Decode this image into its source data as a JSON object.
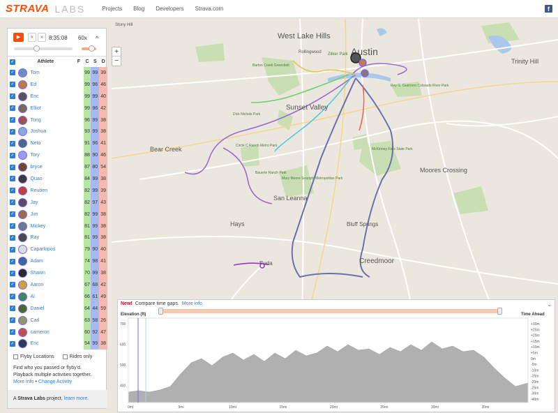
{
  "topbar": {
    "brand": "STRAVA",
    "brand_sub": "LABS",
    "nav": [
      "Projects",
      "Blog",
      "Developers",
      "Strava.com"
    ],
    "facebook_label": "f"
  },
  "map": {
    "labels": [
      "West Lake Hills",
      "Sunset Valley",
      "Bear Creek",
      "San Leanna",
      "Hays",
      "Creedmoor",
      "Moores Crossing",
      "Trinity Hill",
      "Austin",
      "Barton Creek Greenbelt",
      "Mary Moore Searight Metropolitan Park",
      "McKinney Falls State Park",
      "Circle C Ranch Metro Park",
      "Dick Nichols Park",
      "Bauerle Ranch Park",
      "Roy G. Guerrero Colorado River Park",
      "Stony Hill",
      "Rollingwood",
      "Zilker Park",
      "Bluff Springs",
      "Buda"
    ],
    "zoom_in": "+",
    "zoom_out": "−"
  },
  "player": {
    "play_icon": "play-icon",
    "back_label": "«",
    "forward_label": "»",
    "time": "8:35:08",
    "speed": "60x",
    "collapse": "^",
    "timeline_fraction": 0.35,
    "speed_fraction": 0.5
  },
  "table": {
    "headers": {
      "athlete": "Athlete",
      "f": "F",
      "c": "C",
      "s": "S",
      "d": "D"
    },
    "rows": [
      {
        "name": "Tom",
        "f": "",
        "c": "99",
        "s": "99",
        "d": "39"
      },
      {
        "name": "Ed",
        "f": "",
        "c": "99",
        "s": "96",
        "d": "46"
      },
      {
        "name": "Eric",
        "f": "",
        "c": "99",
        "s": "99",
        "d": "40"
      },
      {
        "name": "Elliot",
        "f": "",
        "c": "99",
        "s": "96",
        "d": "42"
      },
      {
        "name": "Tong",
        "f": "",
        "c": "96",
        "s": "99",
        "d": "38"
      },
      {
        "name": "Joshua",
        "f": "",
        "c": "93",
        "s": "99",
        "d": "38"
      },
      {
        "name": "Neto",
        "f": "",
        "c": "91",
        "s": "96",
        "d": "41"
      },
      {
        "name": "Tory",
        "f": "",
        "c": "88",
        "s": "90",
        "d": "46"
      },
      {
        "name": "bryce",
        "f": "",
        "c": "87",
        "s": "80",
        "d": "54"
      },
      {
        "name": "Quao",
        "f": "",
        "c": "84",
        "s": "99",
        "d": "38"
      },
      {
        "name": "Reuben",
        "f": "",
        "c": "82",
        "s": "99",
        "d": "39"
      },
      {
        "name": "Jay",
        "f": "",
        "c": "82",
        "s": "97",
        "d": "43"
      },
      {
        "name": "Jim",
        "f": "",
        "c": "82",
        "s": "99",
        "d": "38"
      },
      {
        "name": "Mickey",
        "f": "",
        "c": "81",
        "s": "99",
        "d": "38"
      },
      {
        "name": "Ray",
        "f": "",
        "c": "81",
        "s": "99",
        "d": "38"
      },
      {
        "name": "Caparlopos",
        "f": "",
        "c": "79",
        "s": "90",
        "d": "40"
      },
      {
        "name": "Adam",
        "f": "",
        "c": "74",
        "s": "98",
        "d": "41"
      },
      {
        "name": "Shawn",
        "f": "",
        "c": "70",
        "s": "99",
        "d": "38"
      },
      {
        "name": "Aaron",
        "f": "",
        "c": "67",
        "s": "68",
        "d": "42"
      },
      {
        "name": "Al",
        "f": "",
        "c": "66",
        "s": "61",
        "d": "49"
      },
      {
        "name": "Daniel",
        "f": "",
        "c": "64",
        "s": "44",
        "d": "59"
      },
      {
        "name": "Carl",
        "f": "",
        "c": "63",
        "s": "58",
        "d": "26"
      },
      {
        "name": "cameron",
        "f": "",
        "c": "60",
        "s": "92",
        "d": "47"
      },
      {
        "name": "Eric",
        "f": "",
        "c": "54",
        "s": "99",
        "d": "38"
      }
    ]
  },
  "footer": {
    "flyby_locations": "Flyby Locations",
    "rides_only": "Rides only",
    "description": "Find who you passed or flyby'd. Playback multiple activities together.",
    "more_info": "More Info",
    "separator": " • ",
    "change_activity": "Change Activity",
    "credit_prefix": "A ",
    "credit_bold": "Strava Labs",
    "credit_mid": " project, ",
    "credit_link": "learn more."
  },
  "elevation": {
    "new_label": "New!",
    "compare_text": "Compare time gaps.",
    "more_info": "More info",
    "left_label": "Elevation (ft)",
    "right_label": "Time Ahead",
    "collapse": "⌄",
    "y_ticks": [
      "700",
      "600",
      "500",
      "400"
    ],
    "right_ticks": [
      "+30m",
      "+25m",
      "+20m",
      "+15m",
      "+10m",
      "+5m",
      "0m",
      "-5m",
      "-10m",
      "-15m",
      "-20m",
      "-25m",
      "-30m",
      "-40m"
    ],
    "x_ticks": [
      "0mi",
      "5mi",
      "10mi",
      "15mi",
      "20mi",
      "25mi",
      "30mi",
      "35mi"
    ],
    "timeline_marker_fraction": 0.025
  },
  "colors": {
    "strava_orange": "#fc4c02",
    "link_blue": "#2d7fd3",
    "col_c": "#b8e6a3",
    "col_s": "#a8b8f0",
    "col_d": "#f4b9b2"
  }
}
